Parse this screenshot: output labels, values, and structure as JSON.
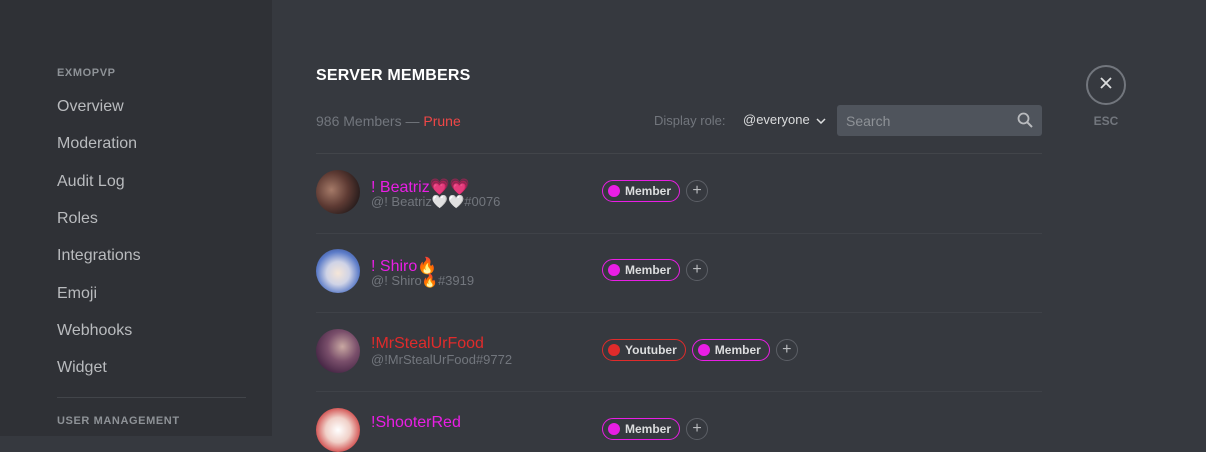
{
  "sidebar": {
    "server_header": "EXMOPVP",
    "items": [
      {
        "label": "Overview"
      },
      {
        "label": "Moderation"
      },
      {
        "label": "Audit Log"
      },
      {
        "label": "Roles"
      },
      {
        "label": "Integrations"
      },
      {
        "label": "Emoji"
      },
      {
        "label": "Webhooks"
      },
      {
        "label": "Widget"
      }
    ],
    "user_mgmt_header": "USER MANAGEMENT"
  },
  "main": {
    "title": "SERVER MEMBERS",
    "member_count": "986 Members —",
    "prune_label": "Prune",
    "display_role_label": "Display role:",
    "display_role_value": "@everyone",
    "search_placeholder": "Search",
    "esc_label": "ESC"
  },
  "colors": {
    "background": "#36393f",
    "sidebar": "#2f3136",
    "member_role": "#e91ee4",
    "youtuber_role": "#e02b2b",
    "prune": "#f04747"
  },
  "members": [
    {
      "display_name": "! Beatriz💗💗",
      "tag": "@! Beatriz🤍🤍#0076",
      "name_color": "#e91ee4",
      "roles": [
        {
          "name": "Member",
          "color": "#e91ee4"
        }
      ]
    },
    {
      "display_name": "! Shiro🔥",
      "tag": "@! Shiro🔥#3919",
      "name_color": "#e91ee4",
      "roles": [
        {
          "name": "Member",
          "color": "#e91ee4"
        }
      ]
    },
    {
      "display_name": "!MrStealUrFood",
      "tag": "@!MrStealUrFood#9772",
      "name_color": "#e02b2b",
      "roles": [
        {
          "name": "Youtuber",
          "color": "#e02b2b"
        },
        {
          "name": "Member",
          "color": "#e91ee4"
        }
      ]
    },
    {
      "display_name": "!ShooterRed",
      "tag": "",
      "name_color": "#e91ee4",
      "roles": [
        {
          "name": "Member",
          "color": "#e91ee4"
        }
      ]
    }
  ],
  "icons": {
    "search": "search-icon",
    "chevron": "chevron-down-icon",
    "close": "close-icon",
    "add_role": "plus-icon"
  }
}
